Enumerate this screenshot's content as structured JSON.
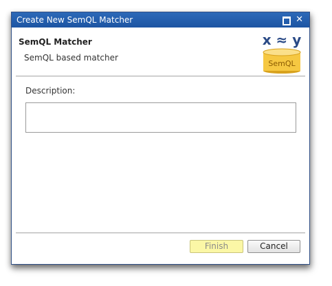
{
  "window": {
    "title": "Create New SemQL Matcher"
  },
  "header": {
    "title": "SemQL Matcher",
    "subtitle": "SemQL based matcher",
    "logo_formula": "x ≈ y",
    "logo_label": "SemQL"
  },
  "form": {
    "description_label": "Description:",
    "description_value": ""
  },
  "buttons": {
    "finish": "Finish",
    "cancel": "Cancel"
  },
  "colors": {
    "titlebar": "#1d55a3",
    "finish_bg": "#fbf7a6",
    "logo_accent": "#2a4a86",
    "db_yellow": "#f6c842"
  }
}
